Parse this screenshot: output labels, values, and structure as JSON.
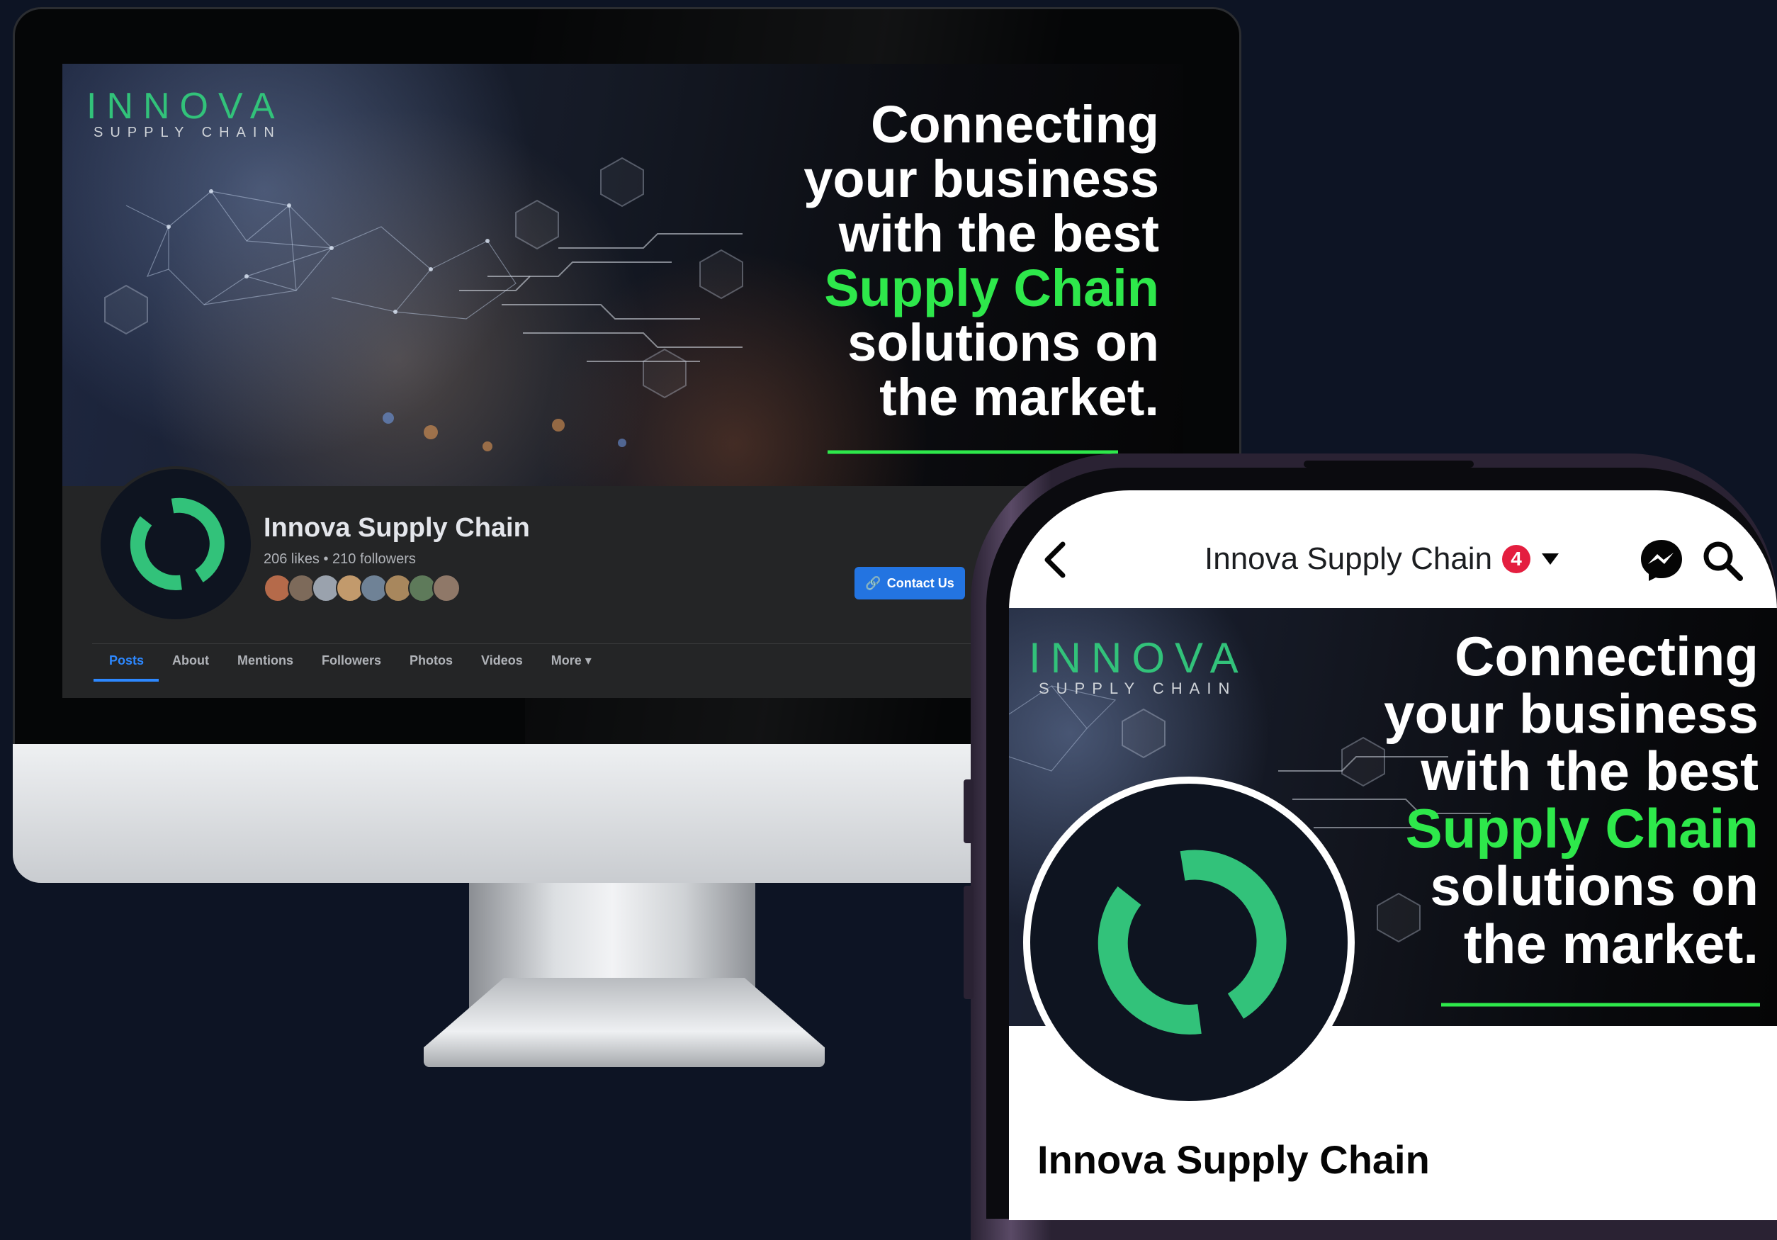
{
  "brand": {
    "logo_main": "INNOVA",
    "logo_sub": "SUPPLY CHAIN"
  },
  "cover": {
    "tagline_lines": [
      "Connecting",
      "your business",
      "with the best"
    ],
    "highlight_line": "Supply Chain",
    "tail_lines": [
      "solutions on",
      "the market."
    ],
    "highlight_color": "#2ee84b"
  },
  "desktop": {
    "page_name": "Innova Supply Chain",
    "stats": "206 likes • 210 followers",
    "contact_button": "Contact Us",
    "tabs": [
      "Posts",
      "About",
      "Mentions",
      "Followers",
      "Photos",
      "Videos",
      "More ▾"
    ],
    "active_tab": "Posts"
  },
  "mobile": {
    "header_title": "Innova Supply Chain",
    "notification_count": "4",
    "page_name": "Innova Supply Chain"
  },
  "colors": {
    "background": "#0d1424",
    "brand_green": "#32c27a",
    "fb_blue": "#2374e1",
    "badge_red": "#e41e3f"
  },
  "icons": [
    "back-chevron-icon",
    "dropdown-caret-icon",
    "messenger-icon",
    "search-icon",
    "link-icon",
    "innova-ring-logo"
  ]
}
